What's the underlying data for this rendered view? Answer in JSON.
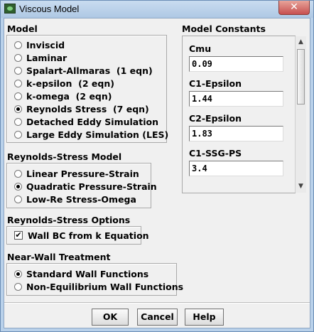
{
  "window": {
    "title": "Viscous Model",
    "close_glyph": "✕"
  },
  "model_group": {
    "title": "Model",
    "selected": "Reynolds Stress  (7 eqn)",
    "options": [
      {
        "label": "Inviscid",
        "selected": false
      },
      {
        "label": "Laminar",
        "selected": false
      },
      {
        "label": "Spalart-Allmaras  (1 eqn)",
        "selected": false
      },
      {
        "label": "k-epsilon  (2 eqn)",
        "selected": false
      },
      {
        "label": "k-omega  (2 eqn)",
        "selected": false
      },
      {
        "label": "Reynolds Stress  (7 eqn)",
        "selected": true
      },
      {
        "label": "Detached Eddy Simulation",
        "selected": false
      },
      {
        "label": "Large Eddy Simulation (LES)",
        "selected": false
      }
    ]
  },
  "rs_model_group": {
    "title": "Reynolds-Stress Model",
    "selected": "Quadratic Pressure-Strain",
    "options": [
      {
        "label": "Linear Pressure-Strain",
        "selected": false
      },
      {
        "label": "Quadratic Pressure-Strain",
        "selected": true
      },
      {
        "label": "Low-Re Stress-Omega",
        "selected": false
      }
    ]
  },
  "rs_options_group": {
    "title": "Reynolds-Stress Options",
    "wall_bc": {
      "label": "Wall BC from k Equation",
      "checked": true,
      "check_glyph": "✔"
    }
  },
  "near_wall_group": {
    "title": "Near-Wall Treatment",
    "selected": "Standard Wall Functions",
    "options": [
      {
        "label": "Standard Wall Functions",
        "selected": true
      },
      {
        "label": "Non-Equilibrium Wall Functions",
        "selected": false
      }
    ]
  },
  "model_constants": {
    "title": "Model Constants",
    "items": [
      {
        "label": "Cmu",
        "value": "0.09"
      },
      {
        "label": "C1-Epsilon",
        "value": "1.44"
      },
      {
        "label": "C2-Epsilon",
        "value": "1.83"
      },
      {
        "label": "C1-SSG-PS",
        "value": "3.4"
      }
    ]
  },
  "scrollbar": {
    "up_glyph": "▲",
    "down_glyph": "▼"
  },
  "buttons": {
    "ok": "OK",
    "cancel": "Cancel",
    "help": "Help"
  }
}
